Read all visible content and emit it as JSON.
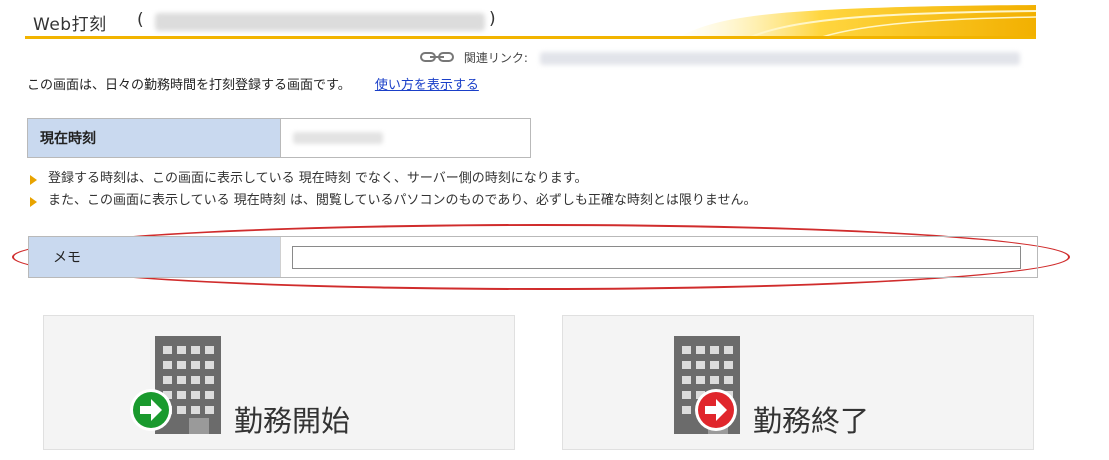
{
  "header": {
    "title": "Web打刻",
    "open_paren": "(",
    "close_paren": ")",
    "accent_color": "#f2b400"
  },
  "related": {
    "label": "関連リンク:",
    "icon": "link-chain-icon"
  },
  "intro": {
    "text": "この画面は、日々の勤務時間を打刻登録する画面です。",
    "help_link": "使い方を表示する"
  },
  "current_time": {
    "label": "現在時刻"
  },
  "notes": [
    "登録する時刻は、この画面に表示している 現在時刻 でなく、サーバー側の時刻になります。",
    "また、この画面に表示している 現在時刻 は、閲覧しているパソコンのものであり、必ずしも正確な時刻とは限りません。"
  ],
  "memo": {
    "label": "メモ",
    "value": "",
    "highlight_color": "#d02c2c"
  },
  "buttons": {
    "start": {
      "label": "勤務開始",
      "icon": "arrow-right-circle-icon",
      "color": "#1a9a2e"
    },
    "end": {
      "label": "勤務終了",
      "icon": "arrow-right-circle-icon",
      "color": "#e0262c"
    }
  }
}
